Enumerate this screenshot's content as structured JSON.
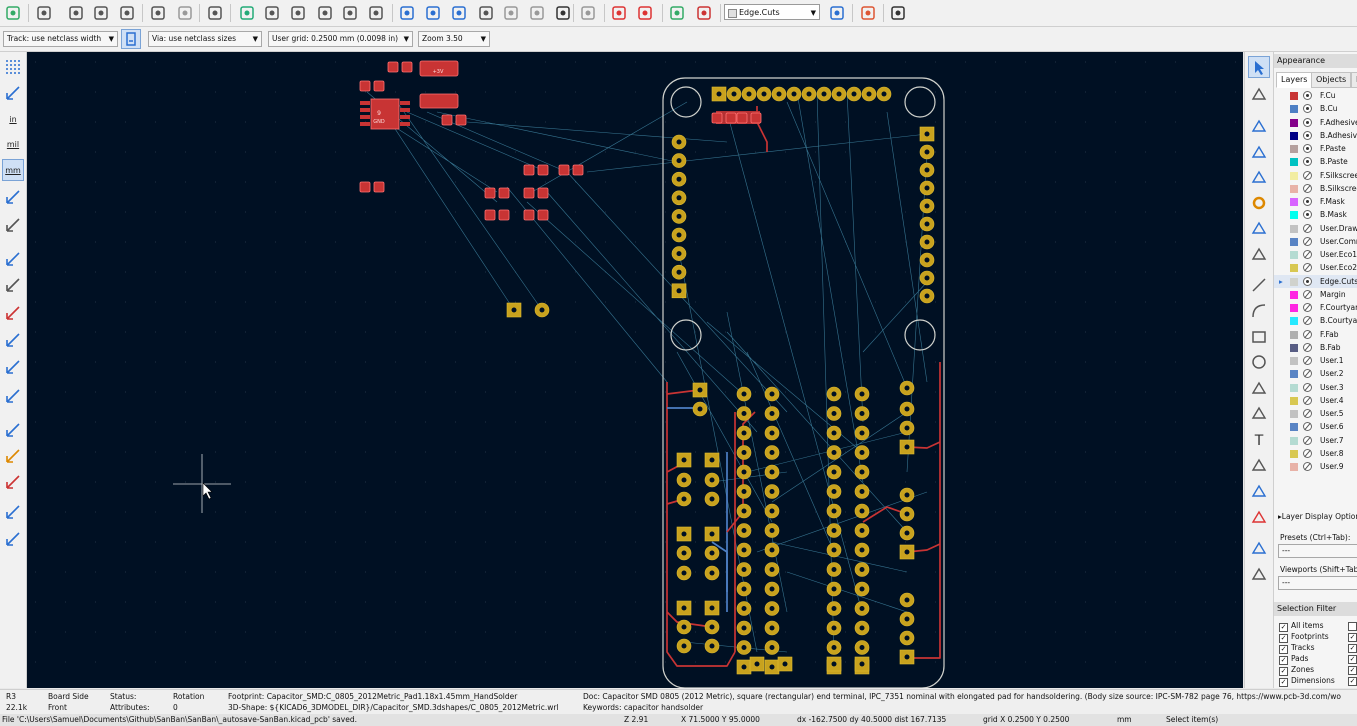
{
  "toolbar": {
    "layer_select": "Edge.Cuts",
    "icons": [
      "board-setup-icon",
      "new-icon",
      "page-settings-icon",
      "print-icon",
      "plot-icon",
      "undo-icon",
      "redo-icon",
      "find-icon",
      "refresh-icon",
      "zoom-in-icon",
      "zoom-out-icon",
      "zoom-fit-icon",
      "zoom-objects-icon",
      "zoom-selection-icon",
      "rotate-ccw-icon",
      "rotate-cw-icon",
      "flip-icon",
      "mirror-icon",
      "group-icon",
      "ungroup-icon",
      "lock-icon",
      "unlock-icon",
      "netlist-icon",
      "drc-icon",
      "update-pcb-icon",
      "footprint-editor-icon",
      "scripting-icon",
      "router-icon",
      "console-icon"
    ]
  },
  "toolbar2": {
    "track": "Track: use netclass width",
    "via": "Via: use netclass sizes",
    "grid": "User grid: 0.2500 mm (0.0098 in)",
    "zoom": "Zoom 3.50"
  },
  "left_toolbar": {
    "in_label": "in",
    "mil_label": "mil",
    "mm_label": "mm"
  },
  "canvas": {
    "part_labels": [
      "+3V",
      "9",
      "GND"
    ]
  },
  "appearance": {
    "title": "Appearance",
    "tabs": [
      "Layers",
      "Objects",
      "N"
    ],
    "layers": [
      {
        "name": "F.Cu",
        "color": "#c83434",
        "visible": true
      },
      {
        "name": "B.Cu",
        "color": "#4d7fc4",
        "visible": true
      },
      {
        "name": "F.Adhesive",
        "color": "#84008a",
        "visible": true
      },
      {
        "name": "B.Adhesive",
        "color": "#000084",
        "visible": true
      },
      {
        "name": "F.Paste",
        "color": "#b4a09e",
        "visible": true
      },
      {
        "name": "B.Paste",
        "color": "#00c2c2",
        "visible": true
      },
      {
        "name": "F.Silkscreen",
        "color": "#f2eda1",
        "visible": false
      },
      {
        "name": "B.Silkscreen",
        "color": "#e8b2a7",
        "visible": false
      },
      {
        "name": "F.Mask",
        "color": "#d864ff",
        "visible": true
      },
      {
        "name": "B.Mask",
        "color": "#02ffee",
        "visible": true
      },
      {
        "name": "User.Drawings",
        "color": "#c2c2c2",
        "visible": false
      },
      {
        "name": "User.Comments",
        "color": "#5984c4",
        "visible": false
      },
      {
        "name": "User.Eco1",
        "color": "#b4dbd2",
        "visible": false
      },
      {
        "name": "User.Eco2",
        "color": "#d8c852",
        "visible": false
      },
      {
        "name": "Edge.Cuts",
        "color": "#d0d2cd",
        "visible": true
      },
      {
        "name": "Margin",
        "color": "#ff26e2",
        "visible": false
      },
      {
        "name": "F.Courtyard",
        "color": "#ff26e2",
        "visible": false
      },
      {
        "name": "B.Courtyard",
        "color": "#26e9ff",
        "visible": false
      },
      {
        "name": "F.Fab",
        "color": "#afafaf",
        "visible": false
      },
      {
        "name": "B.Fab",
        "color": "#585d84",
        "visible": false
      },
      {
        "name": "User.1",
        "color": "#c2c2c2",
        "visible": false
      },
      {
        "name": "User.2",
        "color": "#5984c4",
        "visible": false
      },
      {
        "name": "User.3",
        "color": "#b4dbd2",
        "visible": false
      },
      {
        "name": "User.4",
        "color": "#d8c852",
        "visible": false
      },
      {
        "name": "User.5",
        "color": "#c2c2c2",
        "visible": false
      },
      {
        "name": "User.6",
        "color": "#5984c4",
        "visible": false
      },
      {
        "name": "User.7",
        "color": "#b4dbd2",
        "visible": false
      },
      {
        "name": "User.8",
        "color": "#d8c852",
        "visible": false
      },
      {
        "name": "User.9",
        "color": "#e8b2a7",
        "visible": false
      }
    ],
    "layer_display_options": "Layer Display Options",
    "presets_label": "Presets (Ctrl+Tab):",
    "presets_value": "---",
    "viewports_label": "Viewports (Shift+Tab):",
    "viewports_value": "---",
    "selection_filter_title": "Selection Filter",
    "filters": [
      "All items",
      "Footprints",
      "Tracks",
      "Pads",
      "Zones",
      "Dimensions"
    ]
  },
  "status": {
    "ref": "R3",
    "ref_value": "22.1k",
    "board_side_label": "Board Side",
    "board_side_value": "Front",
    "status_label": "Status:",
    "attributes_label": "Attributes:",
    "rotation_label": "Rotation",
    "rotation_value": "0",
    "footprint": "Footprint: Capacitor_SMD:C_0805_2012Metric_Pad1.18x1.45mm_HandSolder",
    "shape3d": "3D-Shape: ${KICAD6_3DMODEL_DIR}/Capacitor_SMD.3dshapes/C_0805_2012Metric.wrl",
    "doc": "Doc: Capacitor SMD 0805 (2012 Metric), square (rectangular) end terminal, IPC_7351 nominal with elongated pad for handsoldering. (Body size source: IPC-SM-782 page 76, https://www.pcb-3d.com/wo",
    "keywords": "Keywords: capacitor handsolder"
  },
  "msgbar": {
    "file": "File 'C:\\Users\\Samuel\\Documents\\Github\\SanBan\\SanBan\\_autosave-SanBan.kicad_pcb' saved.",
    "z": "Z 2.91",
    "xy": "X 71.5000  Y 95.0000",
    "dxy": "dx -162.7500  dy 40.5000  dist 167.7135",
    "grid": "grid X 0.2500  Y 0.2500",
    "units": "mm",
    "select": "Select item(s)"
  }
}
